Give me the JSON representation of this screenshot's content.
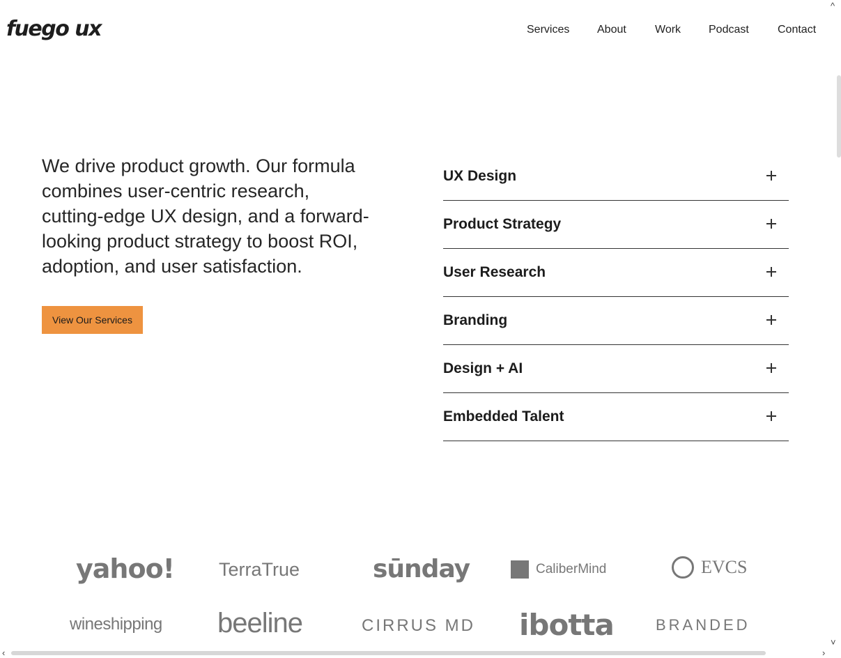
{
  "header": {
    "logo_text": "fuego ux",
    "nav": [
      "Services",
      "About",
      "Work",
      "Podcast",
      "Contact"
    ]
  },
  "hero": {
    "body_lines": [
      "We drive product growth. Our formula",
      "combines user-centric research,",
      "cutting-edge UX design, and a forward-",
      "looking product strategy to boost ROI,",
      "adoption, and user satisfaction."
    ],
    "cta_label": "View Our Services",
    "cta_color": "#ee9340"
  },
  "services": [
    {
      "label": "UX Design",
      "icon": "plus-icon"
    },
    {
      "label": "Product Strategy",
      "icon": "plus-icon"
    },
    {
      "label": "User Research",
      "icon": "plus-icon"
    },
    {
      "label": "Branding",
      "icon": "plus-icon"
    },
    {
      "label": "Design + AI",
      "icon": "plus-icon"
    },
    {
      "label": "Embedded Talent",
      "icon": "plus-icon"
    }
  ],
  "clients": {
    "row1": [
      "yahoo!",
      "TerraTrue",
      "sūnday",
      "CaliberMind",
      "EVCS"
    ],
    "row2": [
      "wineshipping",
      "beeline",
      "CIRRUS MD",
      "ibotta",
      "BRANDED"
    ]
  },
  "scrollbars": {
    "up_arrow": "^",
    "down_arrow": "˅",
    "left_arrow": "‹",
    "right_arrow": "›"
  }
}
